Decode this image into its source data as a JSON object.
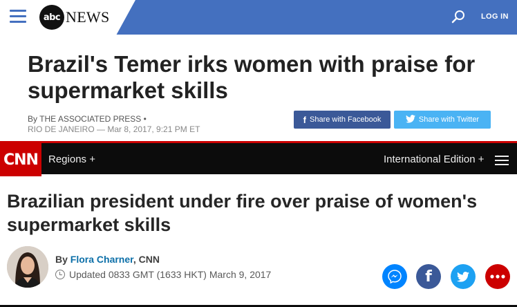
{
  "abc": {
    "brand_mark": "abc",
    "brand_word": "NEWS",
    "login_label": "LOG IN",
    "headline": "Brazil's Temer irks women with praise for supermarket skills",
    "byline_prefix": "By",
    "byline_author": "THE ASSOCIATED PRESS",
    "byline_dot": "•",
    "dateline": "RIO DE JANEIRO — Mar 8, 2017, 9:21 PM ET",
    "share_facebook_label": "Share with Facebook",
    "share_twitter_label": "Share with Twitter",
    "colors": {
      "bar": "#4470bf",
      "facebook": "#3b5998",
      "twitter": "#4ab3f4"
    }
  },
  "cnn": {
    "logo_text": "CNN",
    "regions_label": "Regions +",
    "edition_label": "International Edition +",
    "headline": "Brazilian president under fire over praise of women's supermarket skills",
    "byline_prefix": "By",
    "author_name": "Flora Charner",
    "author_source": ", CNN",
    "updated_text": "Updated 0833 GMT (1633 HKT) March 9, 2017",
    "share_icons": [
      "messenger-icon",
      "facebook-icon",
      "twitter-icon",
      "more-icon"
    ],
    "colors": {
      "brand": "#cc0000",
      "messenger": "#0084ff",
      "facebook": "#3b5998",
      "twitter": "#1da1f2",
      "more": "#cc0000"
    }
  }
}
